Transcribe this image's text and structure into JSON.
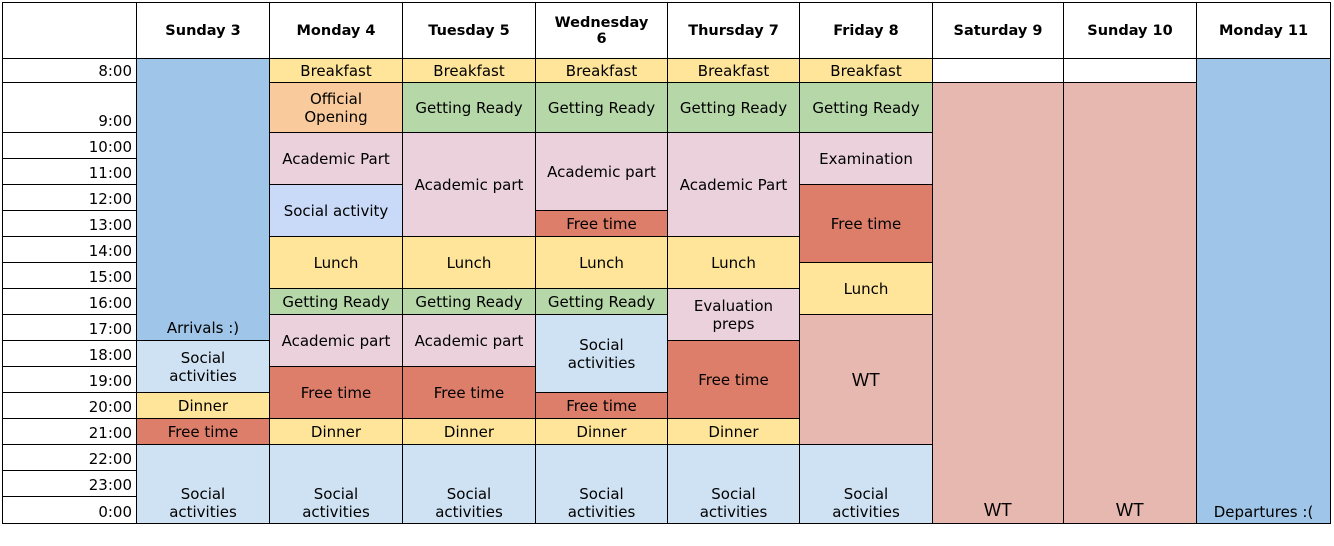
{
  "colors": {
    "blue": "#9fc5e8",
    "light_blue": "#cfe2f3",
    "periwinkle": "#c9daf8",
    "yellow": "#ffe599",
    "orange": "#f9cb9c",
    "green": "#b6d7a8",
    "pink": "#ead1dc",
    "red": "#dd7e6b",
    "salmon": "#e6b8af",
    "white": "#ffffff"
  },
  "days": [
    "",
    "Sunday 3",
    "Monday 4",
    "Tuesday 5",
    "Wednesday\n6",
    "Thursday 7",
    "Friday 8",
    "Saturday 9",
    "Sunday 10",
    "Monday 11"
  ],
  "times": [
    "8:00",
    "9:00",
    "10:00",
    "11:00",
    "12:00",
    "13:00",
    "14:00",
    "15:00",
    "16:00",
    "17:00",
    "18:00",
    "19:00",
    "20:00",
    "21:00",
    "22:00",
    "23:00",
    "0:00"
  ],
  "schedule": [
    [
      {
        "label": "Arrivals :)",
        "color": "blue",
        "rows": 10
      },
      {
        "label": "Social\nactivities",
        "color": "light_blue",
        "rows": 2
      },
      {
        "label": "Dinner",
        "color": "yellow",
        "rows": 1
      },
      {
        "label": "Free time",
        "color": "red",
        "rows": 1
      },
      {
        "label": "Social\nactivities",
        "color": "light_blue",
        "rows": 3
      }
    ],
    [
      {
        "label": "Breakfast",
        "color": "yellow",
        "rows": 1
      },
      {
        "label": "Official\nOpening",
        "color": "orange",
        "rows": 1
      },
      {
        "label": "Academic Part",
        "color": "pink",
        "rows": 2
      },
      {
        "label": "Social activity",
        "color": "periwinkle",
        "rows": 2
      },
      {
        "label": "Lunch",
        "color": "yellow",
        "rows": 2
      },
      {
        "label": "Getting Ready",
        "color": "green",
        "rows": 1
      },
      {
        "label": "Academic part",
        "color": "pink",
        "rows": 2
      },
      {
        "label": "Free time",
        "color": "red",
        "rows": 2
      },
      {
        "label": "Dinner",
        "color": "yellow",
        "rows": 1
      },
      {
        "label": "Social\nactivities",
        "color": "light_blue",
        "rows": 3
      }
    ],
    [
      {
        "label": "Breakfast",
        "color": "yellow",
        "rows": 1
      },
      {
        "label": "Getting Ready",
        "color": "green",
        "rows": 1
      },
      {
        "label": "Academic part",
        "color": "pink",
        "rows": 4
      },
      {
        "label": "Lunch",
        "color": "yellow",
        "rows": 2
      },
      {
        "label": "Getting Ready",
        "color": "green",
        "rows": 1
      },
      {
        "label": "Academic part",
        "color": "pink",
        "rows": 2
      },
      {
        "label": "Free time",
        "color": "red",
        "rows": 2
      },
      {
        "label": "Dinner",
        "color": "yellow",
        "rows": 1
      },
      {
        "label": "Social\nactivities",
        "color": "light_blue",
        "rows": 3
      }
    ],
    [
      {
        "label": "Breakfast",
        "color": "yellow",
        "rows": 1
      },
      {
        "label": "Getting Ready",
        "color": "green",
        "rows": 1
      },
      {
        "label": "Academic part",
        "color": "pink",
        "rows": 3
      },
      {
        "label": "Free time",
        "color": "red",
        "rows": 1
      },
      {
        "label": "Lunch",
        "color": "yellow",
        "rows": 2
      },
      {
        "label": "Getting Ready",
        "color": "green",
        "rows": 1
      },
      {
        "label": "Social\nactivities",
        "color": "light_blue",
        "rows": 3
      },
      {
        "label": "Free time",
        "color": "red",
        "rows": 1
      },
      {
        "label": "Dinner",
        "color": "yellow",
        "rows": 1
      },
      {
        "label": "Social\nactivities",
        "color": "light_blue",
        "rows": 3
      }
    ],
    [
      {
        "label": "Breakfast",
        "color": "yellow",
        "rows": 1
      },
      {
        "label": "Getting Ready",
        "color": "green",
        "rows": 1
      },
      {
        "label": "Academic Part",
        "color": "pink",
        "rows": 4
      },
      {
        "label": "Lunch",
        "color": "yellow",
        "rows": 2
      },
      {
        "label": "Evaluation\npreps",
        "color": "pink",
        "rows": 2
      },
      {
        "label": "Free time",
        "color": "red",
        "rows": 3
      },
      {
        "label": "Dinner",
        "color": "yellow",
        "rows": 1
      },
      {
        "label": "Social\nactivities",
        "color": "light_blue",
        "rows": 3
      }
    ],
    [
      {
        "label": "Breakfast",
        "color": "yellow",
        "rows": 1
      },
      {
        "label": "Getting Ready",
        "color": "green",
        "rows": 1
      },
      {
        "label": "Examination",
        "color": "pink",
        "rows": 2
      },
      {
        "label": "Free time",
        "color": "red",
        "rows": 3
      },
      {
        "label": "Lunch",
        "color": "yellow",
        "rows": 2
      },
      {
        "label": "WT",
        "color": "salmon",
        "rows": 5
      },
      {
        "label": "Social\nactivities",
        "color": "light_blue",
        "rows": 3
      }
    ],
    [
      {
        "label": "",
        "color": "white",
        "rows": 1
      },
      {
        "label": "WT",
        "color": "salmon",
        "rows": 16
      }
    ],
    [
      {
        "label": "",
        "color": "white",
        "rows": 1
      },
      {
        "label": "WT",
        "color": "salmon",
        "rows": 16
      }
    ],
    [
      {
        "label": "Departures :(",
        "color": "blue",
        "rows": 17
      }
    ]
  ]
}
